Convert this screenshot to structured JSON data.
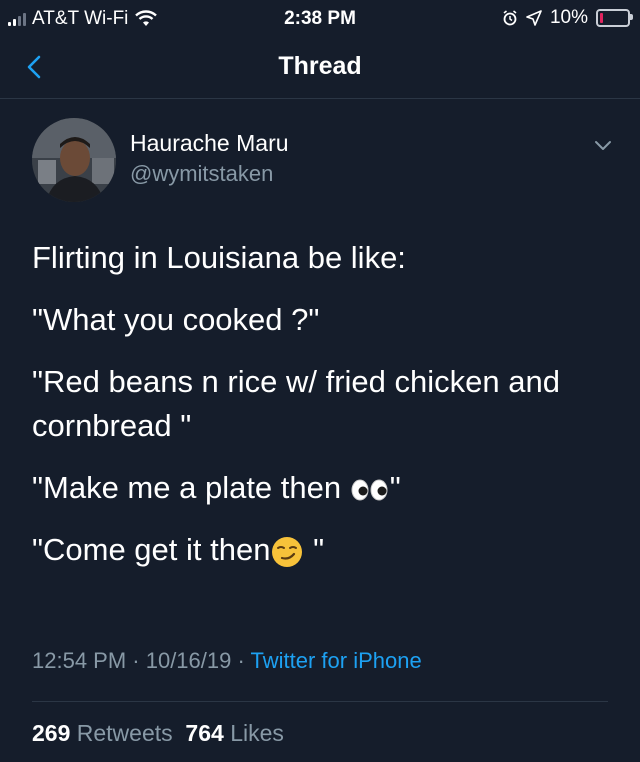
{
  "status_bar": {
    "carrier": "AT&T Wi-Fi",
    "time": "2:38 PM",
    "battery": "10%",
    "battery_level": 0.1,
    "icons": [
      "signal-icon",
      "wifi-icon",
      "alarm-icon",
      "location-icon",
      "battery-icon"
    ]
  },
  "nav": {
    "back_icon": "chevron-left-icon",
    "title": "Thread"
  },
  "tweet": {
    "author_name": "Haurache Maru",
    "author_handle": "@wymitstaken",
    "lines": [
      "Flirting in Louisiana be like:",
      "\"What you cooked ?\"",
      "\"Red beans n rice w/ fried chicken and cornbread \"",
      "\"Make me a plate then ",
      "\"Come get it then"
    ],
    "line4_end": "\"",
    "line5_end": " \"",
    "timestamp": "12:54 PM · 10/16/19 · ",
    "source": "Twitter for iPhone",
    "retweets_count": "269",
    "retweets_label": "Retweets",
    "likes_count": "764",
    "likes_label": "Likes"
  },
  "colors": {
    "background": "#151d2b",
    "accent": "#1da1f2",
    "secondary_text": "#8899a6"
  }
}
